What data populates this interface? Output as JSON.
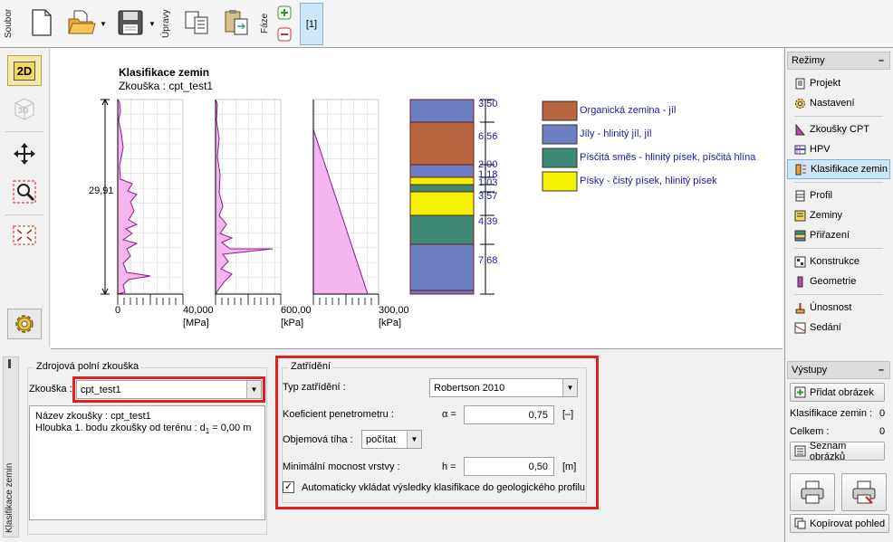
{
  "toolbar": {
    "file_label": "Soubor",
    "edit_label": "Úpravy",
    "stage_label": "Fáze",
    "stage_tab": "[1]"
  },
  "lefttools": {
    "mode_2d": "2D",
    "mode_3d": "3D"
  },
  "canvas": {
    "title": "Klasifikace zemin",
    "subtitle": "Zkouška : cpt_test1",
    "depth_label": "29,91",
    "axis1": {
      "start": "0",
      "end": "40,000",
      "unit": "[MPa]"
    },
    "axis2": {
      "end": "600,00",
      "unit": "[kPa]"
    },
    "axis3": {
      "end": "300,00",
      "unit": "[kPa]"
    },
    "layer_thickness": [
      "3,50",
      "6,56",
      "2,00",
      "1,18",
      "1,03",
      "3,57",
      "4,39",
      "7,68"
    ],
    "legend": [
      {
        "label": "Organická zemina - jíl",
        "color": "#b8663f"
      },
      {
        "label": "Jíly - hlinitý jíl, jíl",
        "color": "#6b7fc2"
      },
      {
        "label": "Písčitá směs - hlinitý písek, písčitá hlína",
        "color": "#3f8a76"
      },
      {
        "label": "Písky - čistý písek, hlinitý písek",
        "color": "#f7f200"
      }
    ]
  },
  "right_panel": {
    "modes_title": "Režimy",
    "items": [
      "Projekt",
      "Nastavení",
      "Zkoušky CPT",
      "HPV",
      "Klasifikace zemin",
      "Profil",
      "Zeminy",
      "Přiřazení",
      "Konstrukce",
      "Geometrie",
      "Únosnost",
      "Sedání"
    ],
    "outputs_title": "Výstupy",
    "add_image": "Přidat obrázek",
    "count_label_1": "Klasifikace zemin :",
    "count_value_1": "0",
    "count_label_2": "Celkem :",
    "count_value_2": "0",
    "image_list": "Seznam obrázků",
    "copy_view": "Kopírovat pohled"
  },
  "bottom": {
    "side_label": "Klasifikace zemin",
    "source_group": "Zdrojová polní zkouška",
    "test_label": "Zkouška :",
    "test_value": "cpt_test1",
    "info_line1": "Název zkoušky : cpt_test1",
    "info_line2_prefix": "Hloubka 1. bodu zkoušky od terénu : d",
    "info_line2_sub": "1",
    "info_line2_suffix": " = 0,00 m",
    "classification_group": "Zatřídění",
    "classification_type_label": "Typ zatřídění :",
    "classification_type_value": "Robertson 2010",
    "penetrometer_label": "Koeficient penetrometru :",
    "penetrometer_symbol": "α =",
    "penetrometer_value": "0,75",
    "penetrometer_unit": "[–]",
    "unit_weight_label": "Objemová tíha :",
    "unit_weight_value": "počítat",
    "min_thickness_label": "Minimální mocnost vrstvy :",
    "min_thickness_symbol": "h =",
    "min_thickness_value": "0,50",
    "min_thickness_unit": "[m]",
    "auto_insert_label": "Automaticky vkládat výsledky klasifikace do geologického profilu"
  }
}
